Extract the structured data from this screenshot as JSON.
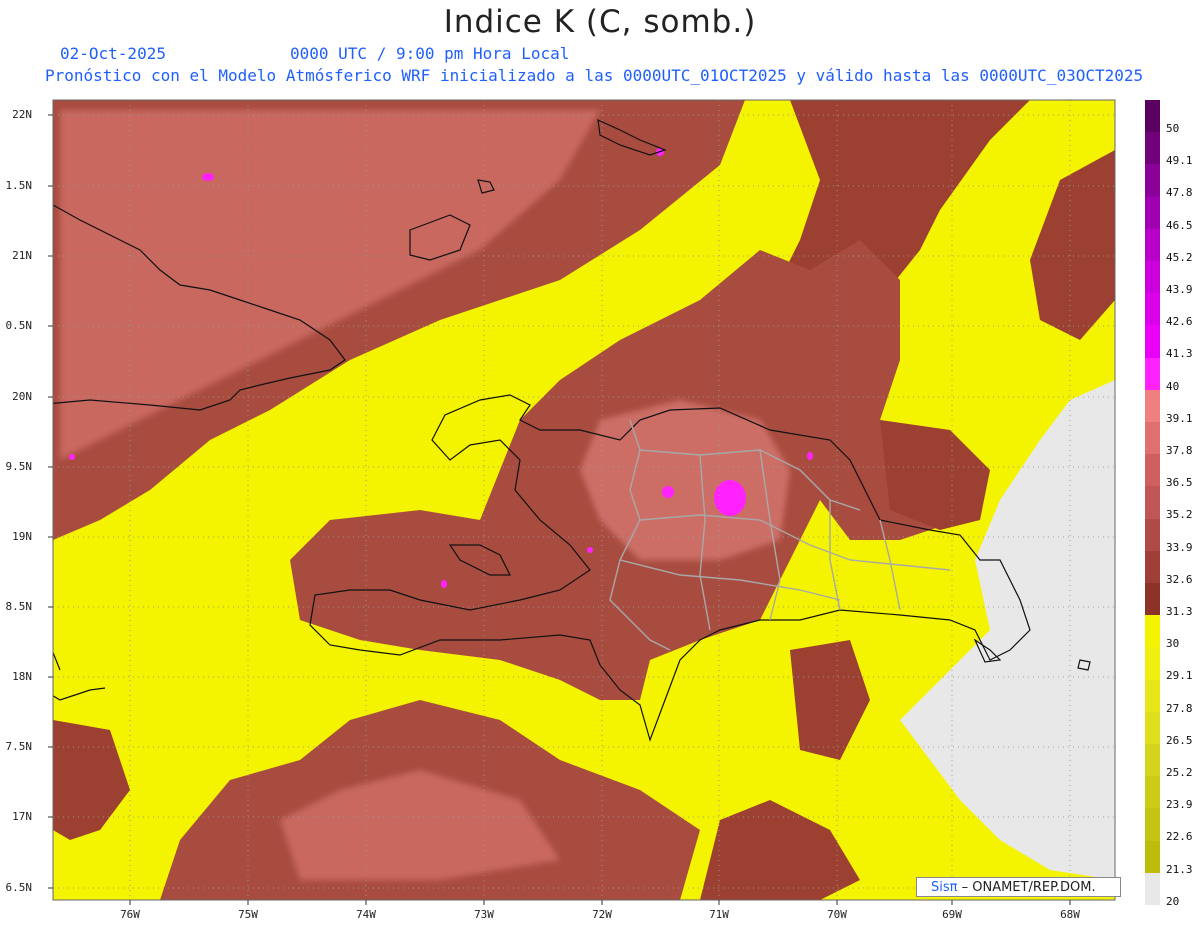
{
  "header": {
    "title": "Indice K (C, somb.)",
    "date": "02-Oct-2025",
    "time": "0000 UTC / 9:00 pm Hora Local",
    "forecast_note": "Pronóstico con el Modelo Atmósferico WRF inicializado a las 0000UTC_01OCT2025 y válido hasta las  0000UTC_03OCT2025"
  },
  "map": {
    "lat_labels": [
      "22N",
      "1.5N",
      "21N",
      "0.5N",
      "20N",
      "9.5N",
      "19N",
      "8.5N",
      "18N",
      "7.5N",
      "17N",
      "6.5N"
    ],
    "lon_labels": [
      "76W",
      "75W",
      "74W",
      "73W",
      "72W",
      "71W",
      "70W",
      "69W",
      "68W"
    ]
  },
  "legend": {
    "labels": [
      "50",
      "49.1",
      "47.8",
      "46.5",
      "45.2",
      "43.9",
      "42.6",
      "41.3",
      "40",
      "39.1",
      "37.8",
      "36.5",
      "35.2",
      "33.9",
      "32.6",
      "31.3",
      "30",
      "29.1",
      "27.8",
      "26.5",
      "25.2",
      "23.9",
      "22.6",
      "21.3",
      "20"
    ],
    "colors": [
      "#5a0060",
      "#72007a",
      "#8a0098",
      "#a000b2",
      "#b800c8",
      "#cc00dc",
      "#dc00ea",
      "#ea00f6",
      "#ff22ff",
      "#f08080",
      "#e07070",
      "#d06060",
      "#c05656",
      "#b04a46",
      "#a03e38",
      "#8c3226",
      "#f4f400",
      "#efef10",
      "#e6e61a",
      "#dede1c",
      "#d4d41c",
      "#cccc18",
      "#c4c412",
      "#bcbc0a",
      "#e8e8e8"
    ]
  },
  "credit": {
    "brand": "Sisπ",
    "text": "– ONAMET/REP.DOM."
  }
}
